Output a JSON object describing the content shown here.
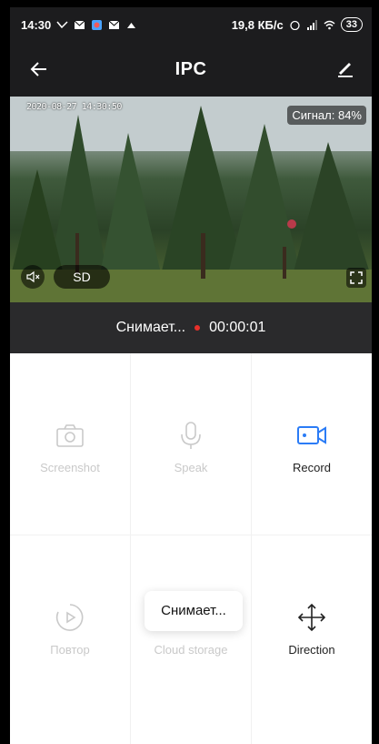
{
  "status_bar": {
    "time": "14:30",
    "speed": "19,8 КБ/с",
    "battery": "33"
  },
  "app_bar": {
    "title": "IPC",
    "back_icon": "arrow-left-icon",
    "edit_icon": "pencil-icon"
  },
  "video": {
    "timestamp": "2020-08-27 14:30:50",
    "signal": "Сигнал: 84%",
    "sd_label": "SD"
  },
  "recording": {
    "status": "Снимает...",
    "timer": "00:00:01",
    "dot_color": "#e8302a"
  },
  "controls": [
    {
      "label": "Screenshot",
      "icon": "camera-icon",
      "enabled": false
    },
    {
      "label": "Speak",
      "icon": "microphone-icon",
      "enabled": false
    },
    {
      "label": "Record",
      "icon": "video-camera-icon",
      "enabled": true
    },
    {
      "label": "Повтор",
      "icon": "playback-icon",
      "enabled": false
    },
    {
      "label": "Cloud storage",
      "icon": "cloud-icon",
      "enabled": false
    },
    {
      "label": "Direction",
      "icon": "direction-arrows-icon",
      "enabled": true
    }
  ],
  "toast": "Снимает...",
  "accent_color": "#2b7cf6"
}
